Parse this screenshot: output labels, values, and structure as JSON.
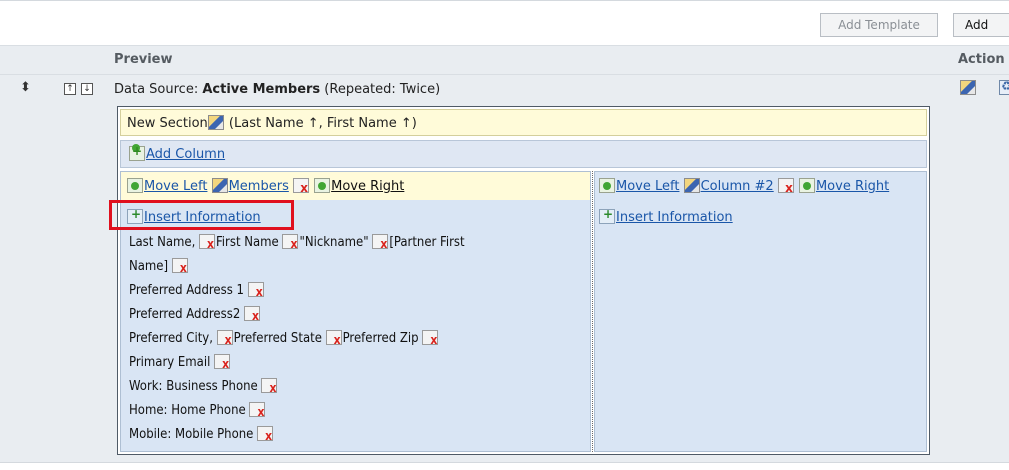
{
  "toolbar": {
    "add_template_label": "Add Template",
    "add_label": "Add"
  },
  "table": {
    "header_preview": "Preview",
    "header_action": "Action"
  },
  "row": {
    "drag_icon": "drag-handle-icon",
    "move_up_glyph": "↑",
    "move_down_glyph": "↓",
    "datasource_prefix": "Data Source: ",
    "datasource_name": "Active Members",
    "datasource_suffix": " (Repeated: Twice)"
  },
  "section": {
    "title": "New Section",
    "sort_text": " (Last Name ↑, First Name ↑)",
    "add_column_label": "Add Column"
  },
  "columns": [
    {
      "move_left": "Move Left",
      "name": "Members",
      "move_right": "Move Right",
      "insert_info": "Insert Information",
      "lines": [
        [
          "Last Name, ",
          "First Name ",
          "\"Nickname\" ",
          "[Partner First"
        ],
        [
          "Name] "
        ],
        [
          "Preferred Address 1 "
        ],
        [
          "Preferred Address2 "
        ],
        [
          "Preferred City, ",
          "Preferred State ",
          "Preferred Zip "
        ],
        [
          "Primary Email "
        ],
        [
          "Work: Business Phone "
        ],
        [
          "Home: Home Phone "
        ],
        [
          "Mobile: Mobile Phone "
        ]
      ]
    },
    {
      "move_left": "Move Left",
      "name": "Column #2",
      "move_right": "Move Right",
      "insert_info": "Insert Information"
    }
  ],
  "colors": {
    "section_title_bg": "#fffbd9",
    "column_bg": "#d9e5f4",
    "link": "#1a56a8",
    "highlight": "#e0101e"
  }
}
